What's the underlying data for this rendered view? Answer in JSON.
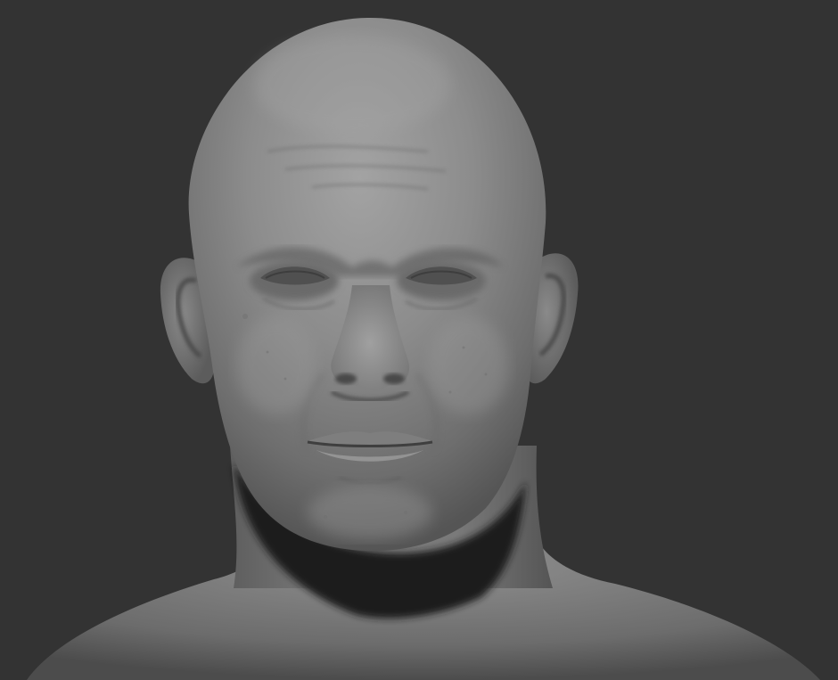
{
  "scene": {
    "subject": "sculpted-head-bust",
    "background_color": "#333333",
    "material_color": "#8a8a8a"
  }
}
